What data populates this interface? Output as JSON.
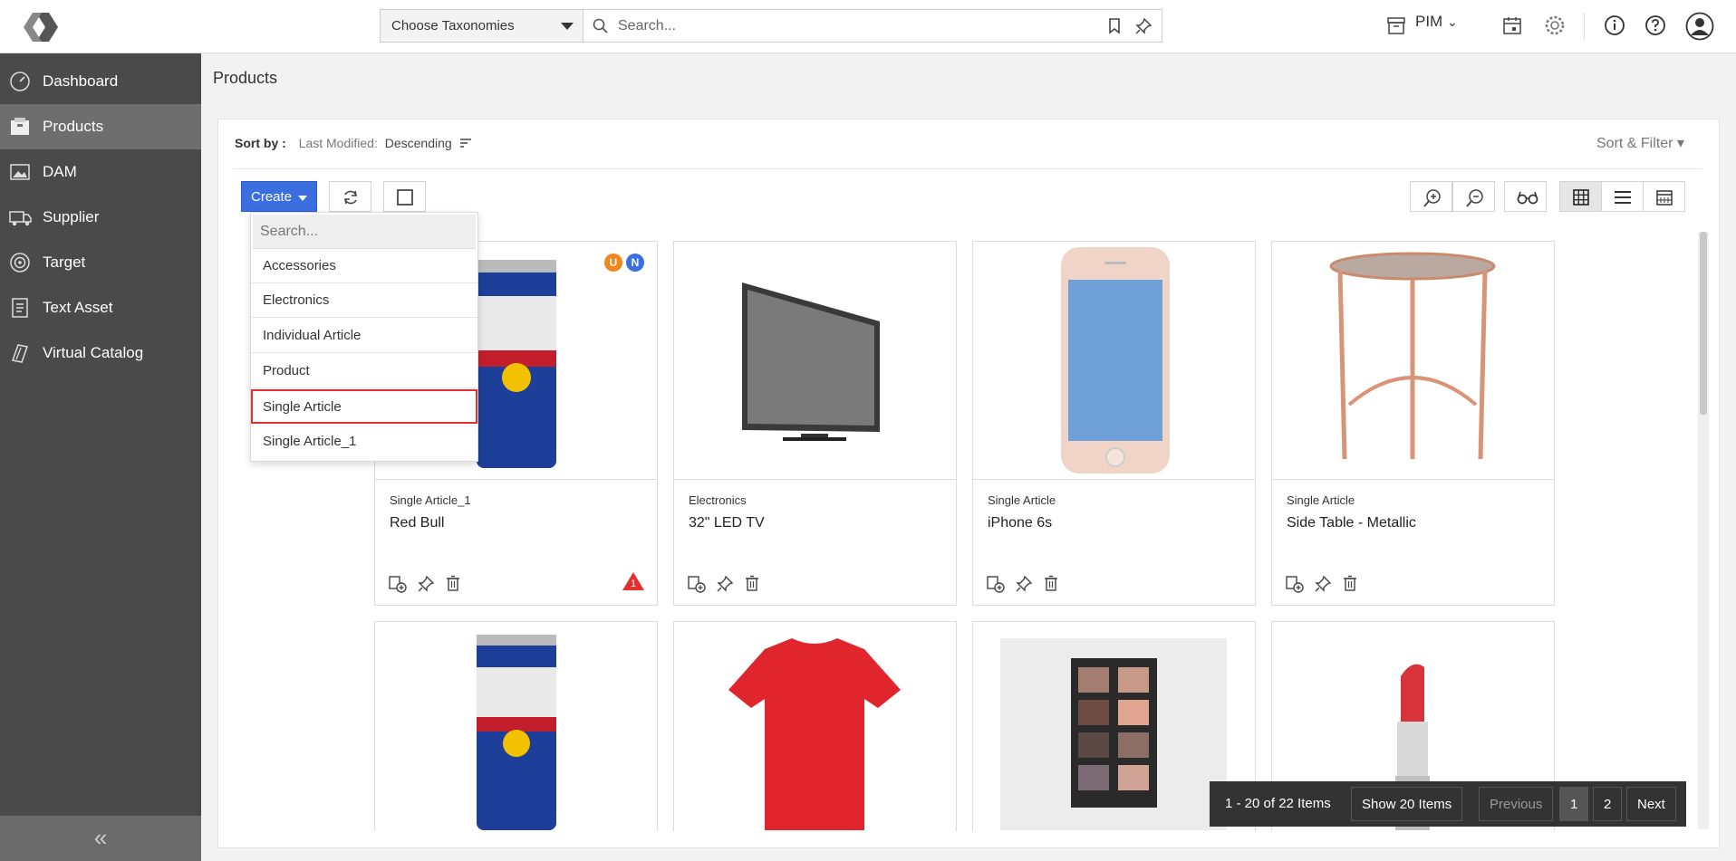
{
  "header": {
    "taxonomy_label": "Choose Taxonomies",
    "search_placeholder": "Search...",
    "module_label": "PIM"
  },
  "sidebar": {
    "items": [
      {
        "label": "Dashboard",
        "icon": "gauge-icon"
      },
      {
        "label": "Products",
        "icon": "box-icon",
        "active": true
      },
      {
        "label": "DAM",
        "icon": "image-icon"
      },
      {
        "label": "Supplier",
        "icon": "truck-icon"
      },
      {
        "label": "Target",
        "icon": "target-icon"
      },
      {
        "label": "Text Asset",
        "icon": "document-icon"
      },
      {
        "label": "Virtual Catalog",
        "icon": "catalog-icon"
      }
    ],
    "collapse_symbol": "«"
  },
  "page": {
    "title": "Products",
    "sort_by_label": "Sort by :",
    "sort_field": "Last Modified:",
    "sort_order": "Descending",
    "sort_filter_label": "Sort & Filter ▾",
    "create_label": "Create"
  },
  "create_menu": {
    "search_placeholder": "Search...",
    "options": [
      "Accessories",
      "Electronics",
      "Individual Article",
      "Product",
      "Single Article",
      "Single Article_1"
    ],
    "highlighted": "Single Article"
  },
  "products": [
    {
      "category": "Single Article_1",
      "name": "Red Bull",
      "badges": [
        "U",
        "N"
      ],
      "warning_count": "1"
    },
    {
      "category": "Electronics",
      "name": "32\" LED TV"
    },
    {
      "category": "Single Article",
      "name": "iPhone 6s"
    },
    {
      "category": "Single Article",
      "name": "Side Table - Metallic"
    }
  ],
  "pager": {
    "range": "1 - 20 of 22 Items",
    "show": "Show 20 Items",
    "previous": "Previous",
    "pages": [
      "1",
      "2"
    ],
    "next": "Next"
  },
  "colors": {
    "accent": "#3b6fe0",
    "sidebar": "#4a4a4a",
    "highlight": "#e23030",
    "badge_u": "#f0861f",
    "badge_n": "#3b6fe0"
  }
}
